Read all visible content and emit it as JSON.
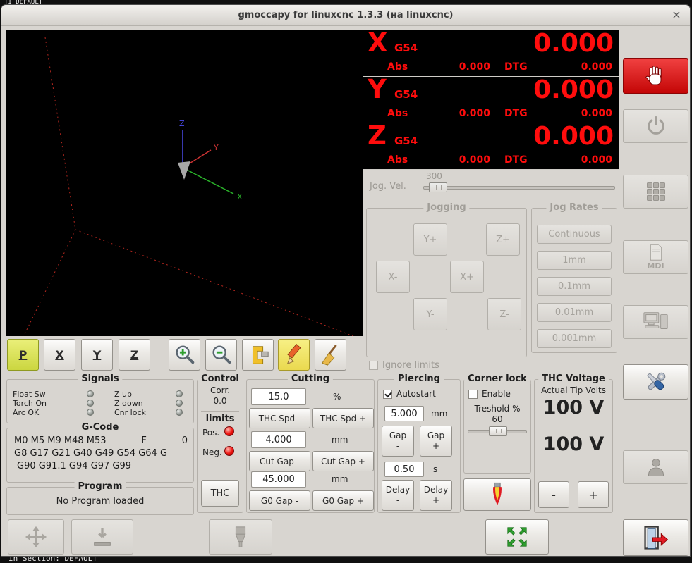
{
  "window": {
    "title": "gmoccapy for linuxcnc   1.3.3 (на linuxcnc)",
    "close": "×"
  },
  "shell": {
    "top_text": "TI   DEFAULT",
    "bottom_text": "In Section:  DEFAULT"
  },
  "view_toolbar": {
    "p": "P",
    "x": "X",
    "y": "Y",
    "z": "Z"
  },
  "dro": {
    "axes": [
      {
        "letter": "X",
        "system": "G54",
        "value": "0.000",
        "abs_label": "Abs",
        "abs_value": "0.000",
        "dtg_label": "DTG",
        "dtg_value": "0.000"
      },
      {
        "letter": "Y",
        "system": "G54",
        "value": "0.000",
        "abs_label": "Abs",
        "abs_value": "0.000",
        "dtg_label": "DTG",
        "dtg_value": "0.000"
      },
      {
        "letter": "Z",
        "system": "G54",
        "value": "0.000",
        "abs_label": "Abs",
        "abs_value": "0.000",
        "dtg_label": "DTG",
        "dtg_value": "0.000"
      }
    ]
  },
  "jog": {
    "vel_label": "Jog. Vel.",
    "vel_value": "300",
    "frame_title": "Jogging",
    "y_plus": "Y+",
    "z_plus": "Z+",
    "x_minus": "X-",
    "x_plus": "X+",
    "y_minus": "Y-",
    "z_minus": "Z-",
    "rates_title": "Jog Rates",
    "rates": [
      "Continuous",
      "1mm",
      "0.1mm",
      "0.01mm",
      "0.001mm"
    ],
    "ignore_limits": "Ignore limits"
  },
  "sidebar": {
    "mdi_label": "MDI"
  },
  "signals": {
    "title": "Signals",
    "left": [
      {
        "label": "Float Sw"
      },
      {
        "label": "Torch On"
      },
      {
        "label": "Arc OK"
      }
    ],
    "right": [
      {
        "label": "Z up"
      },
      {
        "label": "Z down"
      },
      {
        "label": "Cnr lock"
      }
    ]
  },
  "control": {
    "title": "Control",
    "corr_label": "Corr.",
    "corr_value": "0.0",
    "limits_label": "limits",
    "pos_label": "Pos.",
    "neg_label": "Neg.",
    "thc": "THC"
  },
  "cutting": {
    "title": "Cutting",
    "feed": "15.0",
    "feed_unit": "%",
    "thc_spd_minus": "THC Spd -",
    "thc_spd_plus": "THC Spd +",
    "cut_gap": "4.000",
    "cut_gap_unit": "mm",
    "cut_gap_minus": "Cut Gap -",
    "cut_gap_plus": "Cut Gap +",
    "g0_gap": "45.000",
    "g0_gap_unit": "mm",
    "g0_gap_minus": "G0 Gap -",
    "g0_gap_plus": "G0 Gap +"
  },
  "piercing": {
    "title": "Piercing",
    "autostart": "Autostart",
    "gap": "5.000",
    "gap_unit": "mm",
    "gap_word": "Gap",
    "delay": "0.50",
    "delay_unit": "s",
    "delay_word": "Delay",
    "minus": "-",
    "plus": "+"
  },
  "corner_lock": {
    "title": "Corner lock",
    "enable": "Enable",
    "threshold_label": "Treshold %",
    "threshold_value": "60"
  },
  "thc_voltage": {
    "title": "THC Voltage",
    "subtitle": "Actual Tip Volts",
    "actual": "100 V",
    "setpoint": "100 V",
    "minus": "-",
    "plus": "+"
  },
  "gcode": {
    "title": "G-Code",
    "m_line": "M0 M5 M9 M48 M53",
    "f_label": "F",
    "f_value": "0",
    "line2": "G8 G17 G21 G40 G49 G54 G64 G",
    "line3": "G90 G91.1 G94 G97 G99"
  },
  "program": {
    "title": "Program",
    "status": "No Program loaded"
  }
}
